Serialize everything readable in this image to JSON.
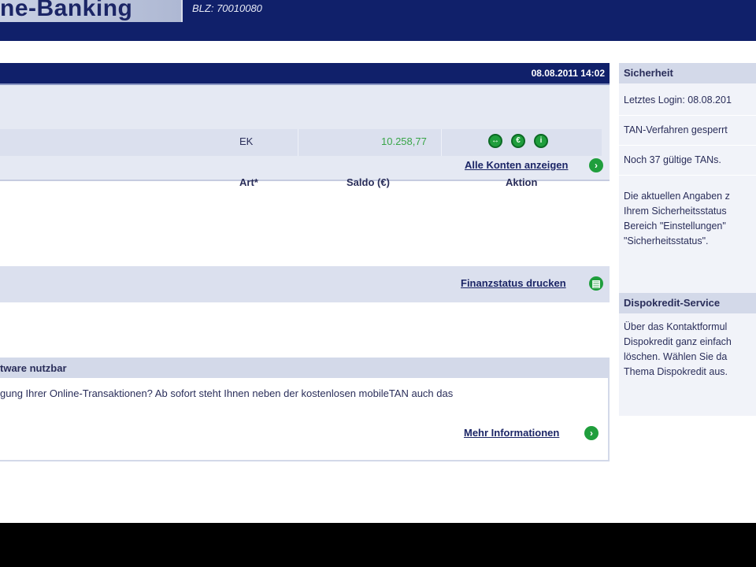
{
  "header": {
    "logo_text": "ne-Banking",
    "blz": "BLZ: 70010080"
  },
  "main": {
    "datetime": "08.08.2011 14:02",
    "accounts": {
      "columns": [
        "Art*",
        "Saldo (€)",
        "Aktion"
      ],
      "rows": [
        {
          "art": "EK",
          "saldo": "10.258,77"
        }
      ],
      "actions": [
        "action-1-icon",
        "action-2-icon",
        "action-3-icon"
      ],
      "all_accounts_link": "Alle Konten anzeigen"
    },
    "print_status_link": "Finanzstatus drucken",
    "news": {
      "title": "tware nutzbar",
      "text": "gung Ihrer Online-Transaktionen? Ab sofort steht Ihnen neben der kostenlosen mobileTAN auch das",
      "more_link": "Mehr Informationen"
    }
  },
  "sidebar": {
    "security": {
      "title": "Sicherheit",
      "last_login": "Letztes Login: 08.08.201",
      "tan_method": "TAN-Verfahren gesperrt",
      "tans_left": "Noch 37 gültige TANs.",
      "info_lines": [
        "Die aktuellen Angaben z",
        "Ihrem Sicherheitsstatus",
        "Bereich \"Einstellungen\"",
        "\"Sicherheitsstatus\"."
      ]
    },
    "dispo": {
      "title": "Dispokredit-Service",
      "lines": [
        "Über das Kontaktformul",
        "Dispokredit ganz einfach",
        "löschen. Wählen Sie da",
        "Thema Dispokredit aus."
      ]
    }
  },
  "colors": {
    "navy": "#10206a",
    "panel": "#e5e9f3",
    "positive": "#39a548",
    "action_green": "#1f9e3c"
  }
}
